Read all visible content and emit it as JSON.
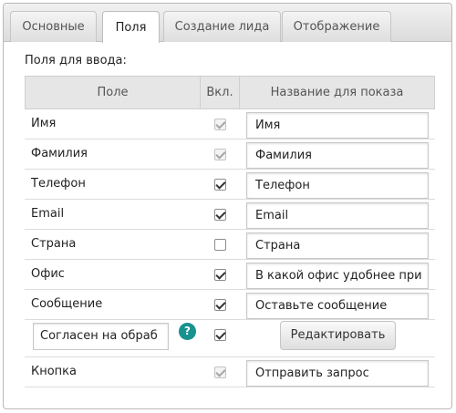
{
  "tabs": [
    {
      "label": "Основные",
      "active": false
    },
    {
      "label": "Поля",
      "active": true
    },
    {
      "label": "Создание лида",
      "active": false
    },
    {
      "label": "Отображение",
      "active": false
    }
  ],
  "section_label": "Поля для ввода:",
  "table": {
    "headers": {
      "field": "Поле",
      "enabled": "Вкл.",
      "display_name": "Название для показа"
    },
    "rows": [
      {
        "field": "Имя",
        "checked": true,
        "disabled": true,
        "display_value": "Имя"
      },
      {
        "field": "Фамилия",
        "checked": true,
        "disabled": true,
        "display_value": "Фамилия"
      },
      {
        "field": "Телефон",
        "checked": true,
        "disabled": false,
        "display_value": "Телефон"
      },
      {
        "field": "Email",
        "checked": true,
        "disabled": false,
        "display_value": "Email"
      },
      {
        "field": "Страна",
        "checked": false,
        "disabled": false,
        "display_value": "Страна"
      },
      {
        "field": "Офис",
        "checked": true,
        "disabled": false,
        "display_value": "В какой офис удобнее при"
      },
      {
        "field": "Сообщение",
        "checked": true,
        "disabled": false,
        "display_value": "Оставьте сообщение"
      },
      {
        "field_input_value": "Согласен на обраб",
        "help_label": "?",
        "checked": true,
        "disabled": false,
        "button_label": "Редактировать"
      },
      {
        "field": "Кнопка",
        "checked": true,
        "disabled": true,
        "display_value": "Отправить запрос"
      }
    ]
  },
  "colors": {
    "accent": "#16928f",
    "header_bg": "#e6e6e6"
  },
  "icons": {
    "help": "question-mark-icon",
    "checkbox": "checkbox-icon"
  }
}
